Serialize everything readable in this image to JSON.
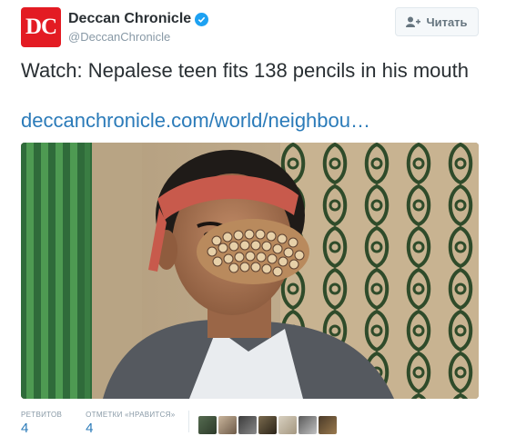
{
  "account": {
    "avatar_text": "DC",
    "name": "Deccan Chronicle",
    "handle": "@DeccanChronicle",
    "verified": true
  },
  "follow_button": {
    "label": "Читать",
    "icon": "add-user-icon"
  },
  "tweet": {
    "text": "Watch: Nepalese teen fits 138 pencils in his mouth",
    "link": "deccanchronicle.com/world/neighbou…"
  },
  "stats": {
    "retweets_label": "РЕТВИТОВ",
    "retweets_count": "4",
    "likes_label": "ОТМЕТКИ «НРАВИТСЯ»",
    "likes_count": "4"
  },
  "colors": {
    "avatar_bg": "#e31b23",
    "link": "#2b7bb9",
    "verified": "#1da1f2"
  }
}
